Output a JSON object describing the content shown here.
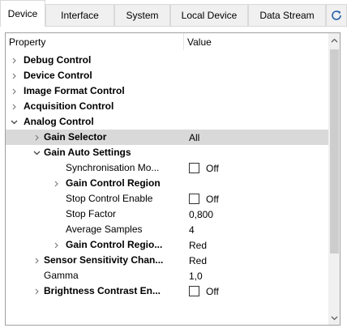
{
  "tabs": [
    {
      "label": "Device",
      "active": true
    },
    {
      "label": "Interface",
      "active": false
    },
    {
      "label": "System",
      "active": false
    },
    {
      "label": "Local Device",
      "active": false
    },
    {
      "label": "Data Stream",
      "active": false
    }
  ],
  "refresh_icon": "refresh-icon",
  "grid": {
    "header": {
      "property": "Property",
      "value": "Value"
    },
    "rows": [
      {
        "label": "Debug Control",
        "level": 0,
        "bold": true,
        "expander": "collapsed",
        "value": null,
        "checkbox": false
      },
      {
        "label": "Device Control",
        "level": 0,
        "bold": true,
        "expander": "collapsed",
        "value": null,
        "checkbox": false
      },
      {
        "label": "Image Format Control",
        "level": 0,
        "bold": true,
        "expander": "collapsed",
        "value": null,
        "checkbox": false
      },
      {
        "label": "Acquisition Control",
        "level": 0,
        "bold": true,
        "expander": "collapsed",
        "value": null,
        "checkbox": false
      },
      {
        "label": "Analog Control",
        "level": 0,
        "bold": true,
        "expander": "expanded",
        "value": null,
        "checkbox": false
      },
      {
        "label": "Gain Selector",
        "level": 1,
        "bold": true,
        "expander": "collapsed",
        "value": "All",
        "checkbox": false,
        "selected": true
      },
      {
        "label": "Gain Auto Settings",
        "level": 1,
        "bold": true,
        "expander": "expanded",
        "value": null,
        "checkbox": false
      },
      {
        "label": "Synchronisation Mo...",
        "level": 2,
        "bold": false,
        "expander": "none",
        "value": "Off",
        "checkbox": true
      },
      {
        "label": "Gain Control Region",
        "level": 2,
        "bold": true,
        "expander": "collapsed",
        "value": null,
        "checkbox": false
      },
      {
        "label": "Stop Control Enable",
        "level": 2,
        "bold": false,
        "expander": "none",
        "value": "Off",
        "checkbox": true
      },
      {
        "label": "Stop Factor",
        "level": 2,
        "bold": false,
        "expander": "none",
        "value": "0,800",
        "checkbox": false
      },
      {
        "label": "Average Samples",
        "level": 2,
        "bold": false,
        "expander": "none",
        "value": "4",
        "checkbox": false
      },
      {
        "label": "Gain Control Regio...",
        "level": 2,
        "bold": true,
        "expander": "collapsed",
        "value": "Red",
        "checkbox": false
      },
      {
        "label": "Sensor Sensitivity Chan...",
        "level": 1,
        "bold": true,
        "expander": "collapsed",
        "value": "Red",
        "checkbox": false
      },
      {
        "label": "Gamma",
        "level": 1,
        "bold": false,
        "expander": "none",
        "value": "1,0",
        "checkbox": false
      },
      {
        "label": "Brightness Contrast En...",
        "level": 1,
        "bold": true,
        "expander": "collapsed",
        "value": "Off",
        "checkbox": true
      }
    ]
  },
  "colors": {
    "selected_row": "#d9d9d9",
    "refresh_icon": "#1f5fa8",
    "scroll_thumb": "#cdcdcd"
  }
}
